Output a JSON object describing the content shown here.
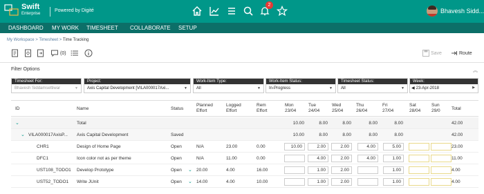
{
  "app": {
    "brand": "Swift",
    "edition": "Enterprise",
    "powered_by": "Powered by Digité",
    "notification_count": "2",
    "user_name": "Bhavesh Sidd..."
  },
  "nav": {
    "items": [
      "DASHBOARD",
      "MY WORK",
      "TIMESHEET",
      "COLLABORATE",
      "SETUP"
    ]
  },
  "breadcrumb": {
    "items": [
      "My Workspace",
      "Timesheet",
      "Time Tracking"
    ],
    "separator": ">"
  },
  "toolbar": {
    "comment_count": "(0)",
    "save_label": "Save",
    "route_label": "Route"
  },
  "filters": {
    "title": "Filter Options",
    "timesheet_for_label": "Timesheet For:",
    "timesheet_for_value": "Bhavesh Siddamsettiwar",
    "project_label": "Project:",
    "project_value": "Axis Capital Development [VILA000017Axi...",
    "work_item_type_label": "Work-Item Type:",
    "work_item_type_value": "All",
    "work_item_status_label": "Work-Item Status:",
    "work_item_status_value": "In-Progress",
    "timesheet_status_label": "Timesheet Status:",
    "timesheet_status_value": "All",
    "week_label": "Week:",
    "week_value": "23-Apr-2018"
  },
  "table": {
    "headers": {
      "id": "ID",
      "name": "Name",
      "status": "Status",
      "planned": [
        "Planned",
        "Effort"
      ],
      "logged": [
        "Logged",
        "Effort"
      ],
      "rem": [
        "Rem",
        "Effort"
      ],
      "days": [
        [
          "Mon",
          "23/04"
        ],
        [
          "Tue",
          "24/04"
        ],
        [
          "Wed",
          "25/04"
        ],
        [
          "Thu",
          "26/04"
        ],
        [
          "Fri",
          "27/04"
        ],
        [
          "Sat",
          "28/04"
        ],
        [
          "Sun",
          "29/0"
        ]
      ],
      "total": "Total"
    },
    "total_row": {
      "name": "Total",
      "days": [
        "10.00",
        "8.00",
        "8.00",
        "8.00",
        "8.00",
        "",
        ""
      ],
      "total": "42.00"
    },
    "project_row": {
      "id": "VILA000017AxisP...",
      "name": "Axis Capital Development",
      "status": "Saved",
      "days": [
        "10.00",
        "8.00",
        "8.00",
        "8.00",
        "8.00",
        "",
        ""
      ],
      "total": "42.00"
    },
    "rows": [
      {
        "id": "CHR1",
        "name": "Design of Home Page",
        "status": "Open",
        "planned": "N/A",
        "logged": "23.00",
        "rem": "0.00",
        "days": [
          "10.00",
          "2.00",
          "2.00",
          "4.00",
          "5.00",
          "",
          ""
        ],
        "total": "23.00"
      },
      {
        "id": "DFC1",
        "name": "Icon color not as per theme",
        "status": "Open",
        "planned": "N/A",
        "logged": "11.00",
        "rem": "0.00",
        "days": [
          "",
          "4.00",
          "2.00",
          "4.00",
          "1.00",
          "",
          ""
        ],
        "total": "11.00"
      },
      {
        "id": "UST108_TODO1",
        "name": "Develop Prototype",
        "status": "Open",
        "planned": "20.00",
        "logged": "4.00",
        "rem": "16.00",
        "days": [
          "",
          "1.00",
          "2.00",
          "",
          "1.00",
          "",
          ""
        ],
        "total": "4.00"
      },
      {
        "id": "UST52_TODO1",
        "name": "Write JUnit",
        "status": "Open",
        "planned": "14.00",
        "logged": "4.00",
        "rem": "10.00",
        "days": [
          "",
          "1.00",
          "2.00",
          "",
          "1.00",
          "",
          ""
        ],
        "total": "4.00"
      }
    ]
  },
  "colors": {
    "header_bg": "#009789",
    "nav_bg": "#0c6f68",
    "accent": "#009789",
    "badge": "#e53935"
  }
}
